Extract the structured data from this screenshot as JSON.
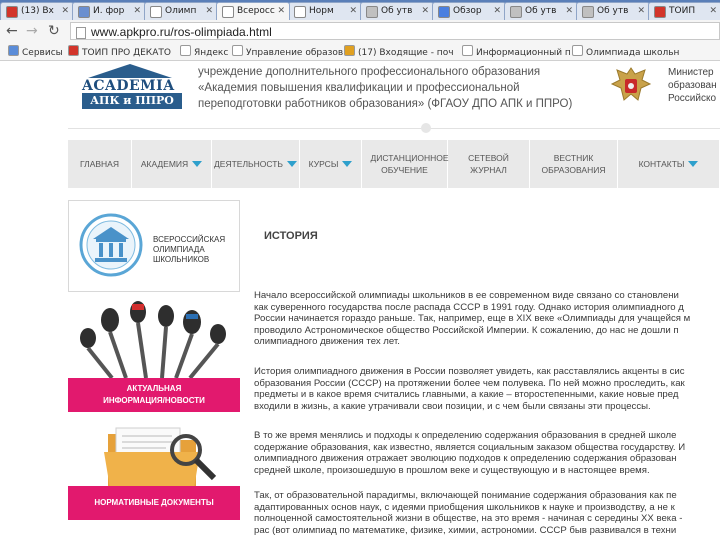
{
  "tabs": [
    {
      "label": "(13) Вх",
      "icon": "mail-favicon-icon",
      "color": "#d2342a"
    },
    {
      "label": "И. фор",
      "icon": "globe-favicon-icon",
      "color": "#6a8fd0"
    },
    {
      "label": "Олимп",
      "icon": "page-favicon-icon",
      "color": "#ffffff"
    },
    {
      "label": "Всеросс",
      "icon": "page-favicon-icon",
      "color": "#ffffff"
    },
    {
      "label": "Норм",
      "icon": "page-favicon-icon",
      "color": "#ffffff"
    },
    {
      "label": "Об утв",
      "icon": "favicon-icon",
      "color": "#c0c0c0"
    },
    {
      "label": "Обзор",
      "icon": "google-favicon-icon",
      "color": "#4a7fe0"
    },
    {
      "label": "Об утв",
      "icon": "favicon-icon",
      "color": "#c0c0c0"
    },
    {
      "label": "Об утв",
      "icon": "favicon-icon",
      "color": "#c0c0c0"
    },
    {
      "label": "ТОИП",
      "icon": "page-favicon-icon",
      "color": "#d2342a"
    }
  ],
  "active_tab_index": 3,
  "address_bar": {
    "url": "www.apkpro.ru/ros-olimpiada.html"
  },
  "bookmarks": [
    {
      "label": "Сервисы",
      "color": "#5a8cd8"
    },
    {
      "label": "ТОИП ПРО ДЕКАТО",
      "color": "#d2342a"
    },
    {
      "label": "Яндекс",
      "color": "#ffffff"
    },
    {
      "label": "Управление образов",
      "color": "#ffffff"
    },
    {
      "label": "(17) Входящие - поч",
      "color": "#e0a020"
    },
    {
      "label": "Информационный п",
      "color": "#ffffff"
    },
    {
      "label": "Олимпиада школьн",
      "color": "#ffffff"
    }
  ],
  "header": {
    "logo_word": "ACADEMIA",
    "logo_sub": "АПК и ППРО",
    "institution_lines": [
      "учреждение дополнительного профессионального образования",
      "«Академия повышения квалификации и профессиональной",
      "переподготовки работников образования» (ФГАОУ ДПО АПК и ППРО)"
    ],
    "ministry_lines": [
      "Министер",
      "образован",
      "Российско"
    ]
  },
  "menu": [
    {
      "label": "ГЛАВНАЯ",
      "dropdown": false
    },
    {
      "label": "АКАДЕМИЯ",
      "dropdown": true
    },
    {
      "label": "ДЕЯТЕЛЬНОСТЬ",
      "dropdown": true
    },
    {
      "label": "КУРСЫ",
      "dropdown": true
    },
    {
      "label": "ДИСТАНЦИОННОЕ ОБУЧЕНИЕ",
      "dropdown": false
    },
    {
      "label": "СЕТЕВОЙ ЖУРНАЛ",
      "dropdown": false
    },
    {
      "label": "ВЕСТНИК ОБРАЗОВАНИЯ",
      "dropdown": false
    },
    {
      "label": "КОНТАКТЫ",
      "dropdown": true
    }
  ],
  "sidebar": {
    "olympiad_lines": [
      "ВСЕРОССИЙСКАЯ",
      "ОЛИМПИАДА",
      "ШКОЛЬНИКОВ"
    ],
    "news_caption": [
      "АКТУАЛЬНАЯ",
      "ИНФОРМАЦИЯ/НОВОСТИ"
    ],
    "docs_caption": "НОРМАТИВНЫЕ ДОКУМЕНТЫ",
    "accent_color": "#e2196e"
  },
  "content": {
    "title": "ИСТОРИЯ",
    "paragraphs": [
      [
        "Начало всероссийской олимпиады школьников в ее современном виде связано со становлени",
        "как суверенного государства после распада СССР в 1991 году. Однако история олимпиадного д",
        "России начинается гораздо раньше. Так, например, еще в XIX веке «Олимпиады для учащейся м",
        "проводило Астрономическое общество Российской Империи. К сожалению, до нас не дошли п",
        "олимпиадного движения тех лет."
      ],
      [
        "История олимпиадного движения в России позволяет увидеть, как расставлялись акценты в сис",
        "образования России (СССР) на протяжении более чем полувека. По ней можно проследить, как",
        "предметы и в какое время считались главными, а какие – второстепенными, какие новые пред",
        "входили в жизнь, а какие утрачивали свои позиции, и с чем были связаны эти процессы."
      ],
      [
        "В то же время менялись и подходы к определению содержания образования в средней школе",
        "содержание образования, как известно, является социальным заказом общества государству. И",
        "олимпиадного движения отражает эволюцию подходов к определению содержания образован",
        "средней школе, произошедшую в прошлом веке и существующую и в настоящее время."
      ],
      [
        "Так, от образовательной парадигмы, включающей понимание содержания образования как пе",
        "адаптированных основ наук, с идеями приобщения школьников к науке и производству, а не к",
        "полноценной самостоятельной жизни в обществе, на это время - начиная с середины XX века -",
        "рас (вот олимпиад по математике, физике, химии, астрономии. СССР быв развивался в техни"
      ]
    ]
  }
}
